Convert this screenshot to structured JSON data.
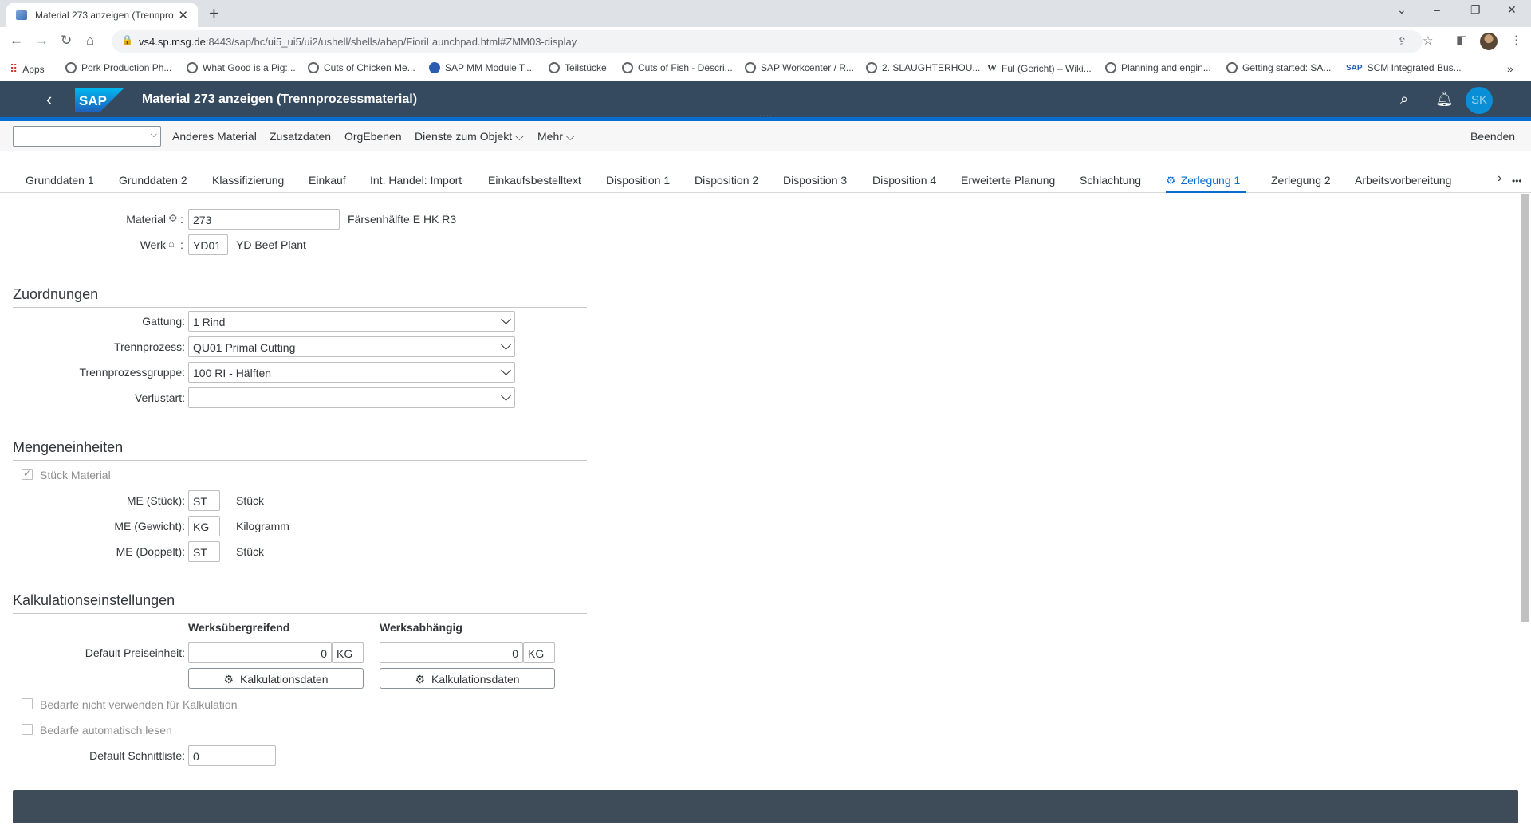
{
  "browser": {
    "tab_title": "Material 273 anzeigen (Trennpro...",
    "url_host": "vs4.sp.msg.de",
    "url_rest": ":8443/sap/bc/ui5_ui5/ui2/ushell/shells/abap/FioriLaunchpad.html#ZMM03-display",
    "bookmarks": [
      "Apps",
      "Pork Production Ph...",
      "What Good is a Pig:...",
      "Cuts of Chicken Me...",
      "SAP MM Module T...",
      "Teilstücke",
      "Cuts of Fish - Descri...",
      "SAP Workcenter / R...",
      "2. SLAUGHTERHOU...",
      "Ful (Gericht) – Wiki...",
      "Planning and engin...",
      "Getting started: SA...",
      "SCM Integrated Bus..."
    ]
  },
  "shell": {
    "logo": "SAP",
    "title": "Material 273 anzeigen (Trennprozessmaterial)",
    "user_initials": "SK",
    "brand_color": "#354a5f",
    "accent_color": "#0a6ed1"
  },
  "toolbar": {
    "select_value": "",
    "items": [
      "Anderes Material",
      "Zusatzdaten",
      "OrgEbenen",
      "Dienste zum Objekt",
      "Mehr"
    ],
    "end": "Beenden"
  },
  "tabs": [
    "Grunddaten 1",
    "Grunddaten 2",
    "Klassifizierung",
    "Einkauf",
    "Int. Handel: Import",
    "Einkaufsbestelltext",
    "Disposition 1",
    "Disposition 2",
    "Disposition 3",
    "Disposition 4",
    "Erweiterte Planung",
    "Schlachtung",
    "Zerlegung 1",
    "Zerlegung 2",
    "Arbeitsvorbereitung"
  ],
  "active_tab": "Zerlegung 1",
  "header": {
    "material_label": "Material",
    "material_value": "273",
    "material_desc": "Färsenhälfte E HK R3",
    "werk_label": "Werk",
    "werk_value": "YD01",
    "werk_desc": "YD Beef Plant"
  },
  "zuordnungen": {
    "title": "Zuordnungen",
    "fields": [
      {
        "label": "Gattung:",
        "value": "1 Rind"
      },
      {
        "label": "Trennprozess:",
        "value": "QU01 Primal Cutting"
      },
      {
        "label": "Trennprozessgruppe:",
        "value": "100 RI - Hälften"
      },
      {
        "label": "Verlustart:",
        "value": ""
      }
    ]
  },
  "mengeneinheiten": {
    "title": "Mengeneinheiten",
    "stueck_material": "Stück Material",
    "stueck_material_checked": true,
    "rows": [
      {
        "label": "ME (Stück):",
        "value": "ST",
        "desc": "Stück"
      },
      {
        "label": "ME (Gewicht):",
        "value": "KG",
        "desc": "Kilogramm"
      },
      {
        "label": "ME (Doppelt):",
        "value": "ST",
        "desc": "Stück"
      }
    ]
  },
  "kalkulation": {
    "title": "Kalkulationseinstellungen",
    "col1": "Werksübergreifend",
    "col2": "Werksabhängig",
    "preis_label": "Default Preiseinheit:",
    "preis1": "0",
    "unit1": "KG",
    "preis2": "0",
    "unit2": "KG",
    "button": "Kalkulationsdaten",
    "check1": "Bedarfe nicht verwenden für Kalkulation",
    "check2": "Bedarfe automatisch lesen",
    "schnitt_label": "Default Schnittliste:",
    "schnitt_value": "0"
  }
}
